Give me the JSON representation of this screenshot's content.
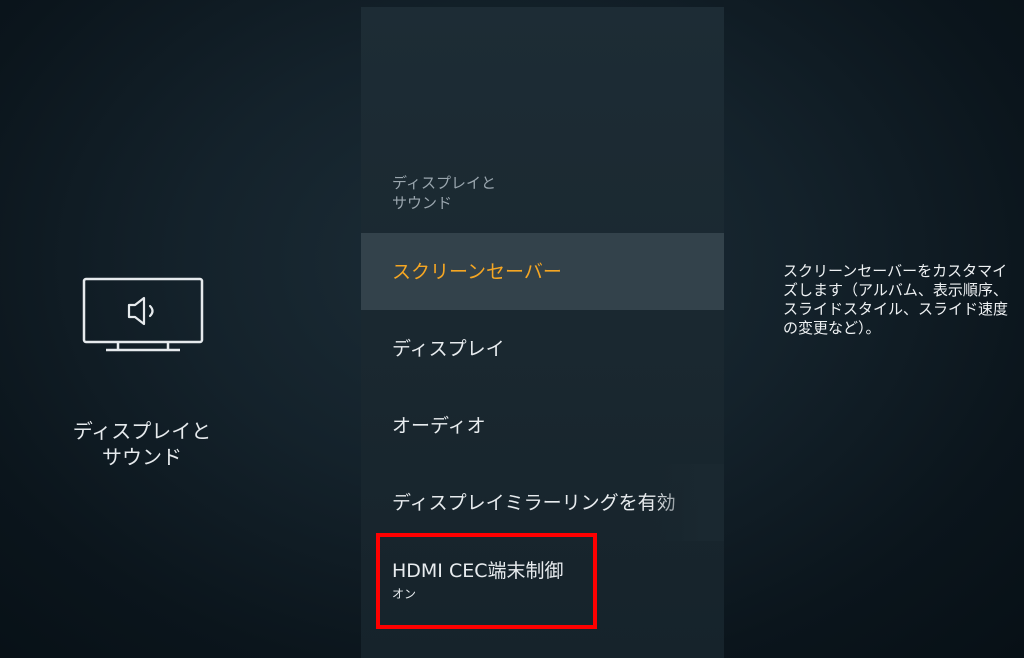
{
  "left_panel": {
    "title": "ディスプレイと\nサウンド",
    "icon": "tv-speaker-icon"
  },
  "menu": {
    "header": "ディスプレイと\nサウンド",
    "items": [
      {
        "label": "スクリーンセーバー",
        "sub": "",
        "selected": true
      },
      {
        "label": "ディスプレイ",
        "sub": ""
      },
      {
        "label": "オーディオ",
        "sub": ""
      },
      {
        "label": "ディスプレイミラーリングを有効",
        "sub": ""
      },
      {
        "label": "HDMI CEC端末制御",
        "sub": "オン"
      }
    ]
  },
  "description": {
    "text": "スクリーンセーバーをカスタマイズします（アルバム、表示順序、スライドスタイル、スライド速度の変更など）。"
  },
  "colors": {
    "accent": "#f5a623",
    "highlight_box": "#ff0000",
    "selected_bg": "#33424b"
  }
}
